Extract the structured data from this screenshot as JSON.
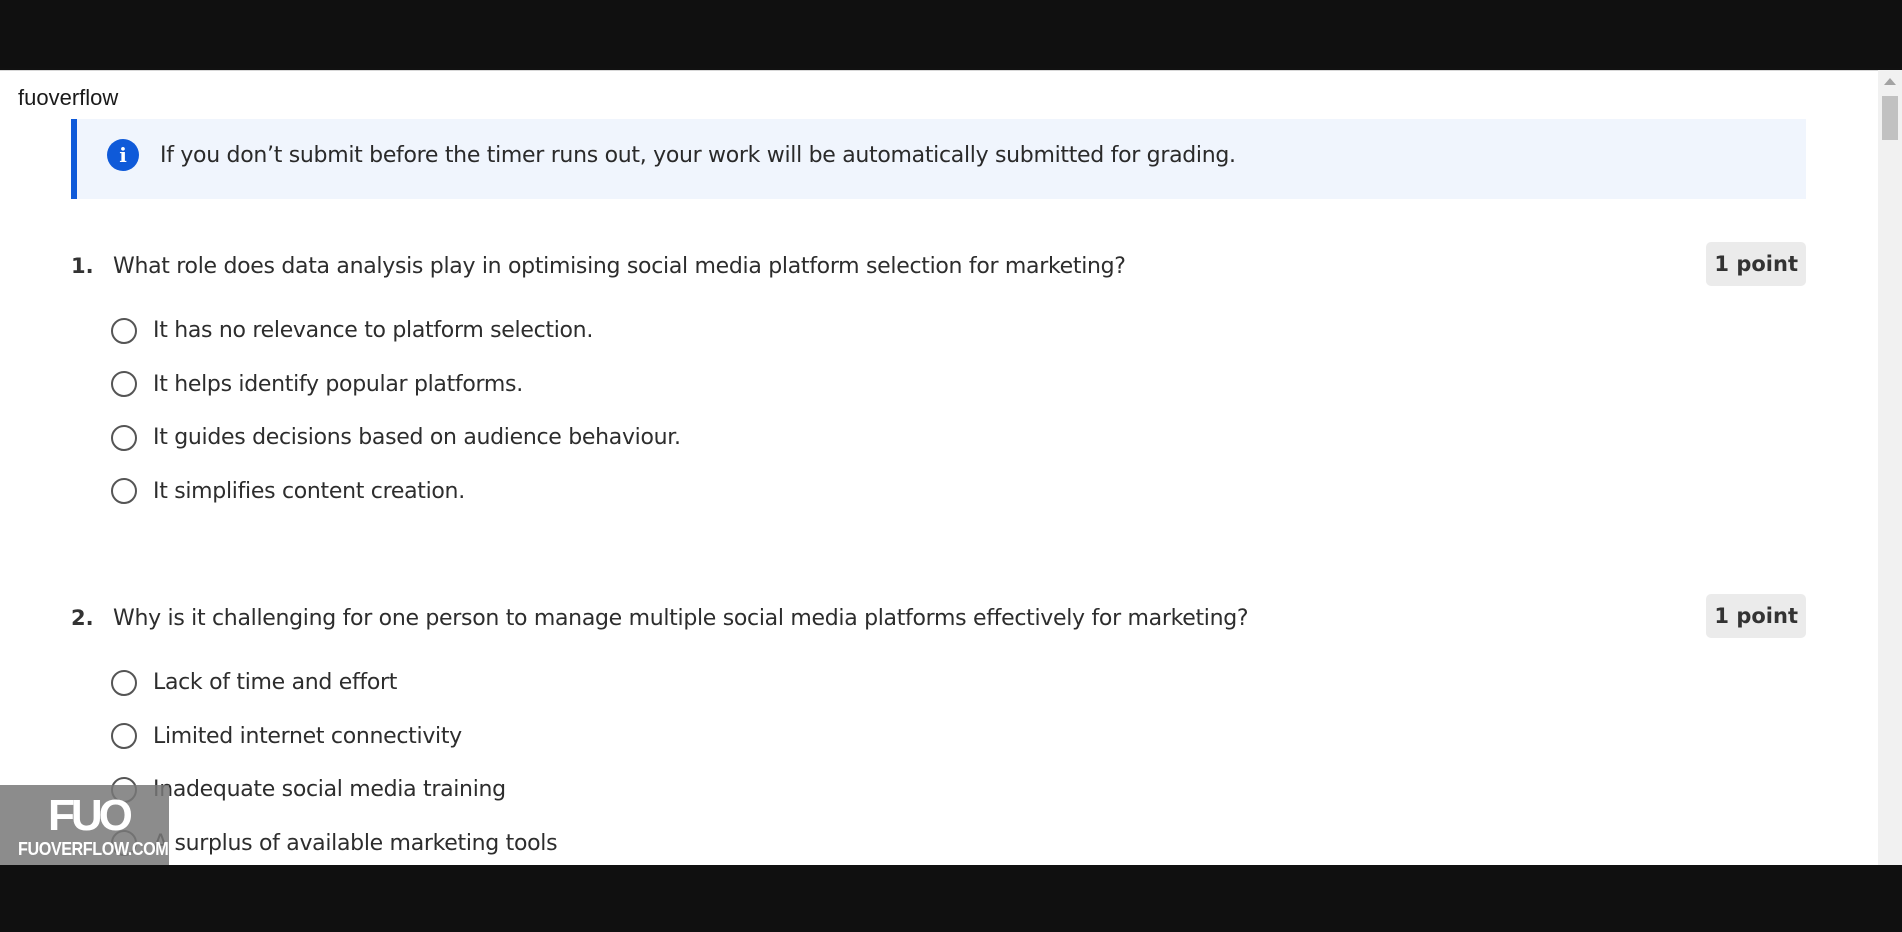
{
  "site": {
    "title": "fuoverflow"
  },
  "banner": {
    "icon": "info-icon",
    "text": "If you don’t submit before the timer runs out, your work will be automatically submitted for grading."
  },
  "questions": [
    {
      "number": "1.",
      "text": "What role does data analysis play in optimising social media platform selection for marketing?",
      "points": "1 point",
      "options": [
        "It has no relevance to platform selection.",
        "It helps identify popular platforms.",
        "It guides decisions based on audience behaviour.",
        "It simplifies content creation."
      ]
    },
    {
      "number": "2.",
      "text": "Why is it challenging for one person to manage multiple social media platforms effectively for marketing?",
      "points": "1 point",
      "options": [
        "Lack of time and effort",
        "Limited internet connectivity",
        "Inadequate social media training",
        "A surplus of available marketing tools"
      ]
    }
  ],
  "watermark": {
    "logo": "FUO",
    "text": "FUOVERFLOW.COM"
  },
  "colors": {
    "accent": "#0f5ad9",
    "banner_bg": "#f0f5fd",
    "points_bg": "#ebebeb"
  }
}
